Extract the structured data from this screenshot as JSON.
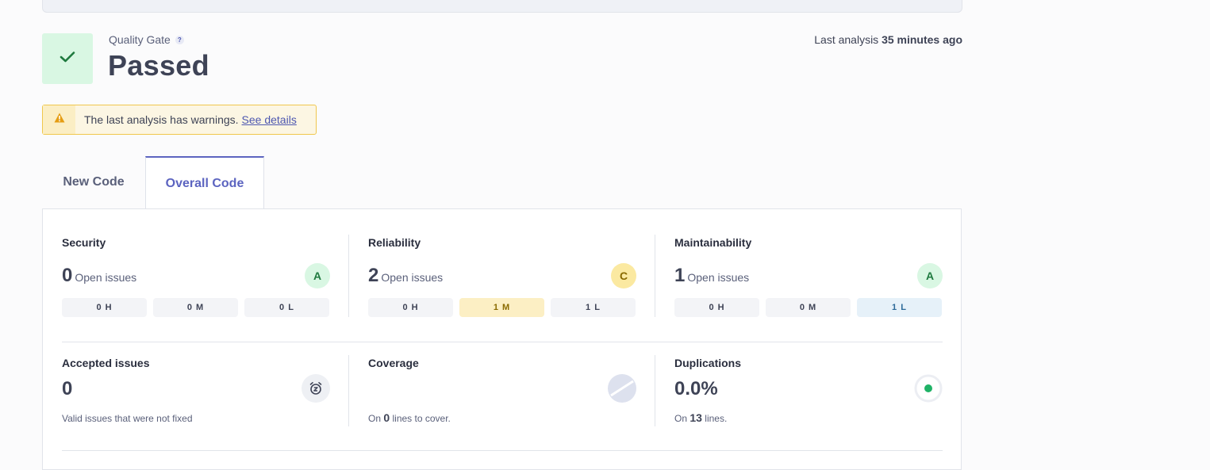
{
  "quality_gate": {
    "label": "Quality Gate",
    "help_glyph": "?",
    "status": "Passed",
    "status_icon": "checkmark-icon",
    "status_color": "#1f7a3f"
  },
  "last_analysis": {
    "prefix": "Last analysis",
    "value": "35 minutes ago"
  },
  "warning": {
    "text": "The last analysis has warnings.",
    "link": "See details",
    "icon": "warning-triangle-icon",
    "color": "#e59d13"
  },
  "tabs": [
    {
      "label": "New Code",
      "active": false
    },
    {
      "label": "Overall Code",
      "active": true
    }
  ],
  "metrics": {
    "security": {
      "title": "Security",
      "count": "0",
      "count_label": "Open issues",
      "rating": "A",
      "chips": [
        "0 H",
        "0 M",
        "0 L"
      ]
    },
    "reliability": {
      "title": "Reliability",
      "count": "2",
      "count_label": "Open issues",
      "rating": "C",
      "chips": [
        "0 H",
        "1 M",
        "1 L"
      ]
    },
    "maintainability": {
      "title": "Maintainability",
      "count": "1",
      "count_label": "Open issues",
      "rating": "A",
      "chips": [
        "0 H",
        "0 M",
        "1 L"
      ]
    },
    "accepted": {
      "title": "Accepted issues",
      "count": "0",
      "note": "Valid issues that were not fixed",
      "icon": "alarm-clock-icon"
    },
    "coverage": {
      "title": "Coverage",
      "note_prefix": "On",
      "note_value": "0",
      "note_suffix": "lines to cover.",
      "icon": "no-coverage-icon"
    },
    "duplications": {
      "title": "Duplications",
      "value": "0.0%",
      "note_prefix": "On",
      "note_value": "13",
      "note_suffix": "lines.",
      "icon": "duplication-dot-icon"
    }
  },
  "colors": {
    "rating_a_bg": "#d9f7e3",
    "rating_a_fg": "#1f7a3f",
    "rating_c_bg": "#fbe9a1",
    "rating_c_fg": "#8a6a00",
    "chip_medium_bg": "#fcefc4",
    "chip_low_bg": "#e6f1f9",
    "accent": "#5c64c0"
  }
}
